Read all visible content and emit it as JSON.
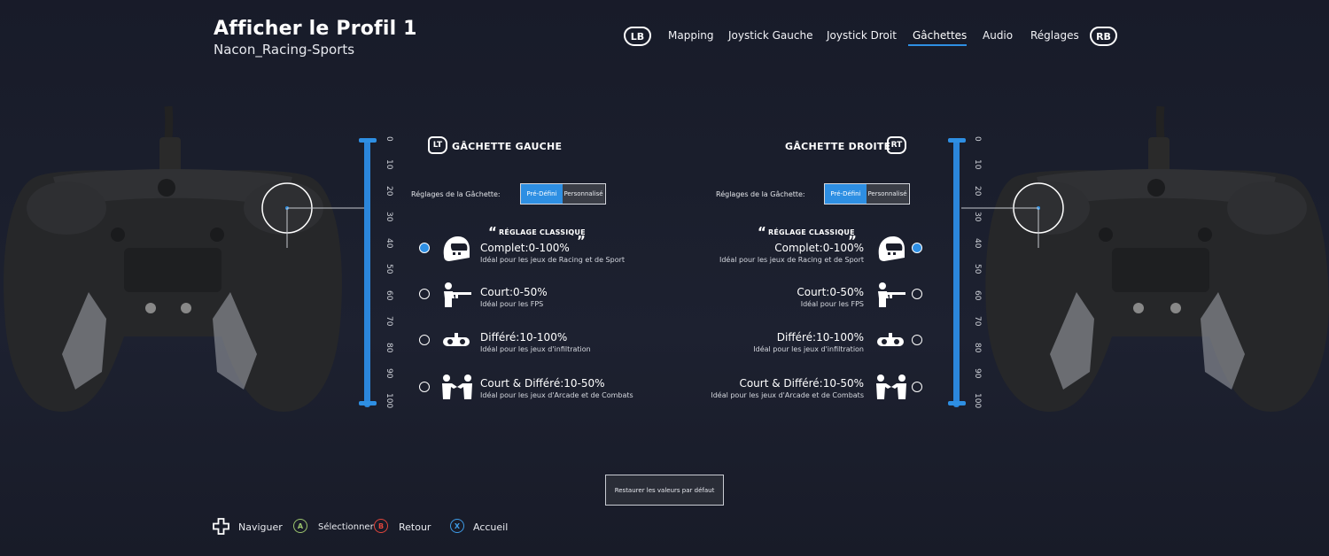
{
  "header": {
    "title": "Afficher le Profil 1",
    "subtitle": "Nacon_Racing-Sports"
  },
  "nav": {
    "lb": "LB",
    "rb": "RB",
    "tabs": [
      {
        "label": "Mapping",
        "active": false
      },
      {
        "label": "Joystick Gauche",
        "active": false
      },
      {
        "label": "Joystick Droit",
        "active": false
      },
      {
        "label": "Gâchettes",
        "active": true
      },
      {
        "label": "Audio",
        "active": false
      },
      {
        "label": "Réglages",
        "active": false
      }
    ]
  },
  "scale": [
    "0",
    "10",
    "20",
    "30",
    "40",
    "50",
    "60",
    "70",
    "80",
    "90",
    "100"
  ],
  "left_trigger": {
    "badge": "LT",
    "heading": "GÂCHETTE GAUCHE",
    "settings_label": "Réglages de la Gâchette:",
    "mode_preset": "Pré-Défini",
    "mode_custom": "Personnalisé",
    "selected_mode": "Pré-Défini"
  },
  "right_trigger": {
    "badge": "RT",
    "heading": "GÂCHETTE DROITE",
    "settings_label": "Réglages de la Gâchette:",
    "mode_preset": "Pré-Défini",
    "mode_custom": "Personnalisé",
    "selected_mode": "Pré-Défini"
  },
  "classic_label": "RÉGLAGE CLASSIQUE",
  "quote_open": "“",
  "quote_close": "”",
  "options": [
    {
      "title": "Complet:0-100%",
      "desc": "Idéal pour les jeux de Racing et de Sport",
      "icon": "helmet-icon",
      "selected": true
    },
    {
      "title": "Court:0-50%",
      "desc": "Idéal pour les FPS",
      "icon": "shooter-icon",
      "selected": false
    },
    {
      "title": "Différé:10-100%",
      "desc": "Idéal pour les jeux d'infiltration",
      "icon": "sneak-goggles-icon",
      "selected": false
    },
    {
      "title": "Court & Différé:10-50%",
      "desc": "Idéal pour les jeux d'Arcade et de Combats",
      "icon": "fighters-icon",
      "selected": false
    }
  ],
  "restore_label": "Restaurer les valeurs par défaut",
  "footer": {
    "navigate": "Naviguer",
    "select": "Sélectionner",
    "back": "Retour",
    "home": "Accueil",
    "btn_a": "A",
    "btn_b": "B",
    "btn_x": "X"
  },
  "colors": {
    "accent": "#2e8fe3",
    "btn_a": "#9bc46d",
    "btn_b": "#e0453b",
    "btn_x": "#3e9be6"
  }
}
